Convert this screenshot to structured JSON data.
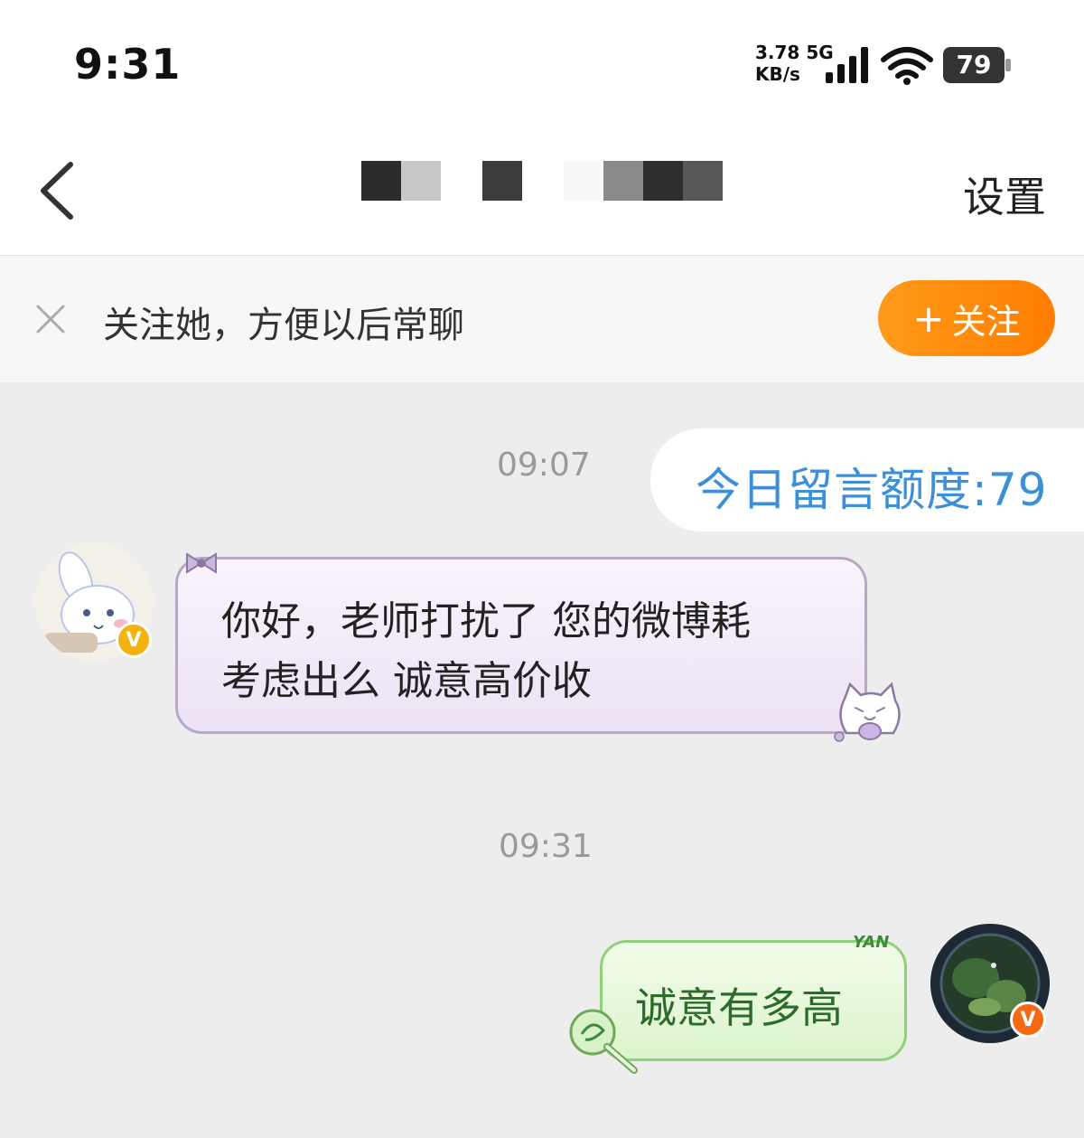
{
  "status_bar": {
    "time": "9:31",
    "net_speed_value": "3.78",
    "net_type": "5G",
    "net_speed_unit": "KB/s",
    "battery_level": "79",
    "icons": [
      "signal-icon",
      "wifi-icon",
      "battery-icon"
    ]
  },
  "header": {
    "back_icon": "chevron-left-icon",
    "settings_label": "设置"
  },
  "follow_bar": {
    "message": "关注她，方便以后常聊",
    "button_label": "关注",
    "button_icon": "plus-icon",
    "close_icon": "close-icon",
    "button_color": "#ff8c0a"
  },
  "conversation": {
    "messages": [
      {
        "time": "09:07",
        "side": "right",
        "type": "system",
        "text": "今日留言额度:79",
        "color": "#3d8fd8"
      },
      {
        "side": "left",
        "type": "text",
        "lines": [
          "你好，老师打扰了 您的微博耗",
          "考虑出么  诚意高价收"
        ],
        "verified_badge": "V"
      },
      {
        "time": "09:31",
        "side": "right",
        "type": "text",
        "text": "诚意有多高",
        "sticker_text": "YAN",
        "verified_badge": "V"
      }
    ]
  }
}
